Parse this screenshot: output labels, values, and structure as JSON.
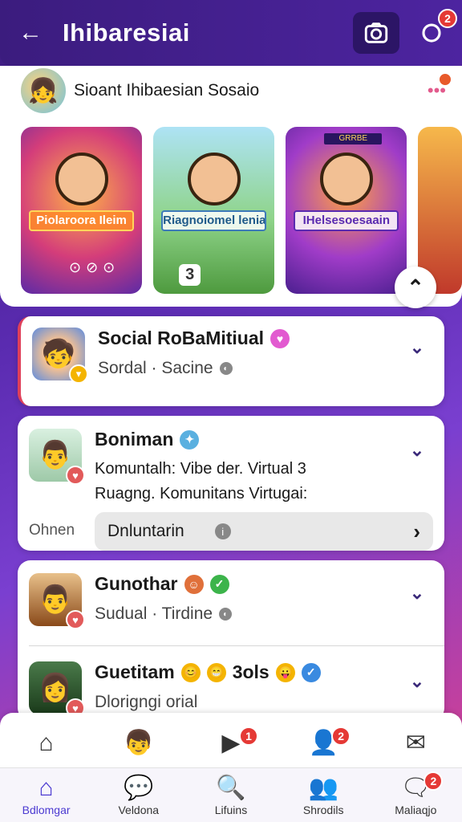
{
  "header": {
    "title": "Ihibaresiai",
    "notification_count": "2"
  },
  "community": {
    "name": "Sioant Ihibaesian Sosaio"
  },
  "banners": [
    {
      "label": "Piolaroora Ileim"
    },
    {
      "label": "Riagnoiomel lenia",
      "count": "3"
    },
    {
      "label": "IHelsesoesaain",
      "tag": "GRRBE"
    }
  ],
  "posts": [
    {
      "title": "Social RoBaMitiual",
      "subtitle": "Sordal · Sacine"
    },
    {
      "title": "Boniman",
      "line1": "Komuntalh: Vibe der. Virtual 3",
      "line2": "Ruagng. Komunitans Virtugai:",
      "status": "Ohnen",
      "reply_placeholder": "Dnluntarin"
    },
    {
      "title": "Gunothar",
      "subtitle": "Sudual · Tirdine"
    },
    {
      "title": "Guetitam",
      "title_extra": "3ols",
      "subtitle": "Dlorigngi orial"
    }
  ],
  "nav_top": [
    {
      "icon": "home-icon",
      "glyph": "⌂"
    },
    {
      "icon": "profile-avatar-icon",
      "glyph": "👦"
    },
    {
      "icon": "video-play-icon",
      "glyph": "▶",
      "badge": "1"
    },
    {
      "icon": "people-icon",
      "glyph": "👤",
      "badge": "2"
    },
    {
      "icon": "mail-icon",
      "glyph": "✉"
    }
  ],
  "nav_bottom": [
    {
      "label": "Bdlomgar",
      "icon": "home-icon",
      "glyph": "⌂"
    },
    {
      "label": "Veldona",
      "icon": "chat-icon",
      "glyph": "💬"
    },
    {
      "label": "Lifuins",
      "icon": "search-icon",
      "glyph": "🔍"
    },
    {
      "label": "Shrodils",
      "icon": "friends-icon",
      "glyph": "👥"
    },
    {
      "label": "Maliaqjo",
      "icon": "messages-icon",
      "glyph": "🗨",
      "badge": "2"
    }
  ],
  "colors": {
    "accent": "#4b3ad1",
    "header": "#3b1c7e",
    "badge": "#e53935"
  }
}
